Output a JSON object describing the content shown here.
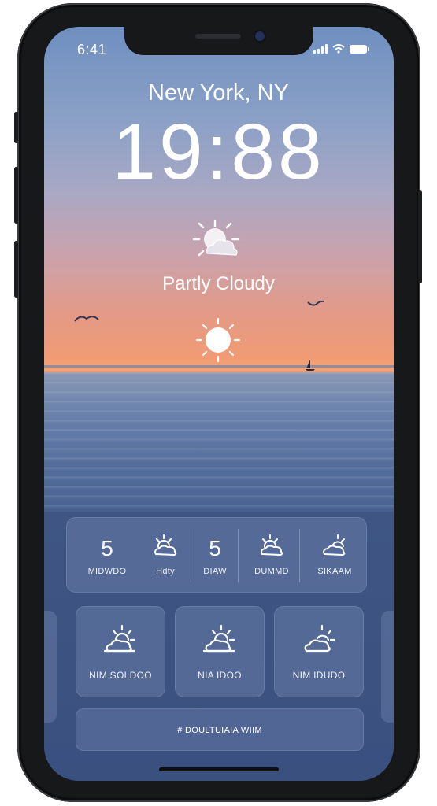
{
  "status_bar": {
    "time": "6:41",
    "signal_icon": "cellular-signal-icon",
    "wifi_icon": "wifi-icon",
    "battery_icon": "battery-icon"
  },
  "lock_screen": {
    "location": "New York, NY",
    "clock": "19:88",
    "condition_icon": "partly-cloudy-sun-icon",
    "condition": "Partly Cloudy",
    "sun_icon": "sun-icon"
  },
  "forecast_card": {
    "items": [
      {
        "value": "5",
        "label": "MIDWDO"
      },
      {
        "icon": "cloud-sun-icon",
        "label": "Hdty"
      },
      {
        "value": "5",
        "label": "DIAW"
      },
      {
        "icon": "cloud-sun-icon",
        "label": "DUMMD"
      },
      {
        "icon": "cloud-sun-icon",
        "label": "SIKAAM"
      }
    ]
  },
  "tiles": [
    {
      "icon": "cloud-sun-icon",
      "label": "NIM SOLDOO"
    },
    {
      "icon": "cloud-sun-icon",
      "label": "NIA IDOO"
    },
    {
      "icon": "cloud-sun-icon",
      "label": "NIM IDUDO"
    }
  ],
  "bottom_bar": {
    "label": "# DOULTUIAIA WIIM"
  },
  "colors": {
    "sky_top": "#6f8fc0",
    "sunset": "#f19b73",
    "sea": "#5d76a3",
    "panel": "#3a507f",
    "frame": "#17181a"
  }
}
